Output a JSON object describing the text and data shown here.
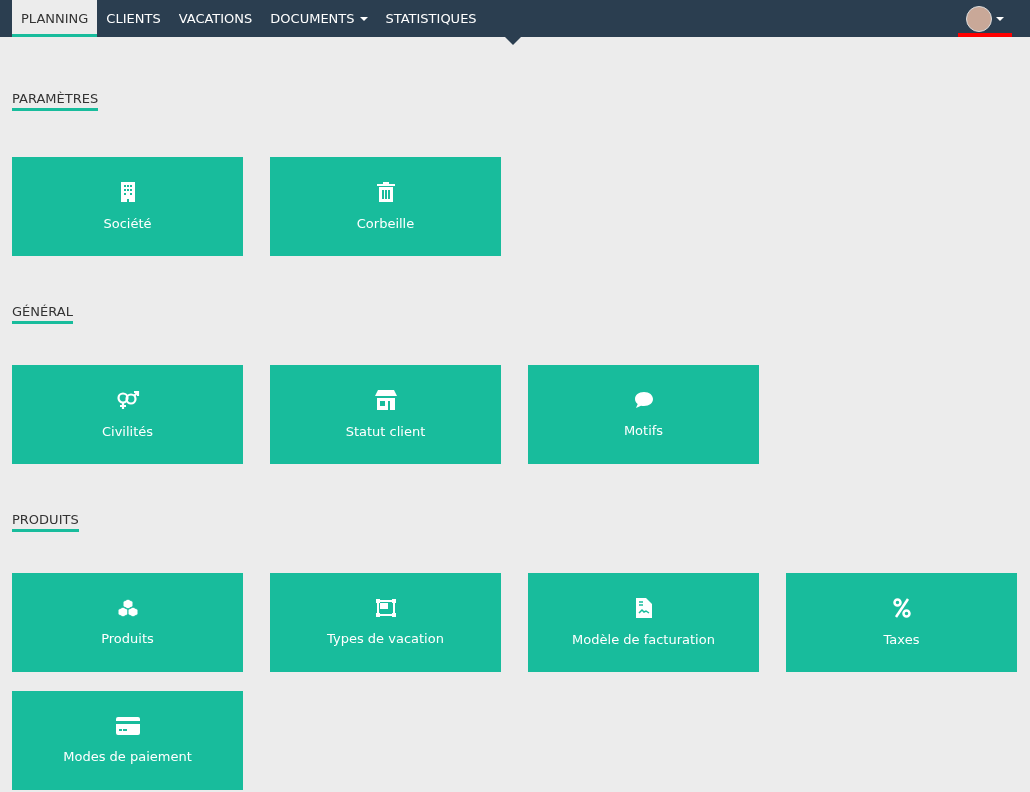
{
  "nav": {
    "items": [
      {
        "label": "PLANNING",
        "selected": true,
        "dropdown": false
      },
      {
        "label": "CLIENTS",
        "selected": false,
        "dropdown": false
      },
      {
        "label": "VACATIONS",
        "selected": false,
        "dropdown": false
      },
      {
        "label": "DOCUMENTS",
        "selected": false,
        "dropdown": true
      },
      {
        "label": "STATISTIQUES",
        "selected": false,
        "dropdown": false
      }
    ]
  },
  "sections": [
    {
      "title": "PARAMÈTRES",
      "tiles": [
        {
          "label": "Société",
          "kind": "building"
        },
        {
          "label": "Corbeille",
          "kind": "trash"
        }
      ]
    },
    {
      "title": "GÉNÉRAL",
      "tiles": [
        {
          "label": "Civilités",
          "kind": "gender"
        },
        {
          "label": "Statut client",
          "kind": "store"
        },
        {
          "label": "Motifs",
          "kind": "comment"
        }
      ]
    },
    {
      "title": "PRODUITS",
      "tiles": [
        {
          "label": "Produits",
          "kind": "cubes"
        },
        {
          "label": "Types de vacation",
          "kind": "frame"
        },
        {
          "label": "Modèle de facturation",
          "kind": "document"
        },
        {
          "label": "Taxes",
          "kind": "percent"
        },
        {
          "label": "Modes de paiement",
          "kind": "card"
        }
      ]
    }
  ]
}
